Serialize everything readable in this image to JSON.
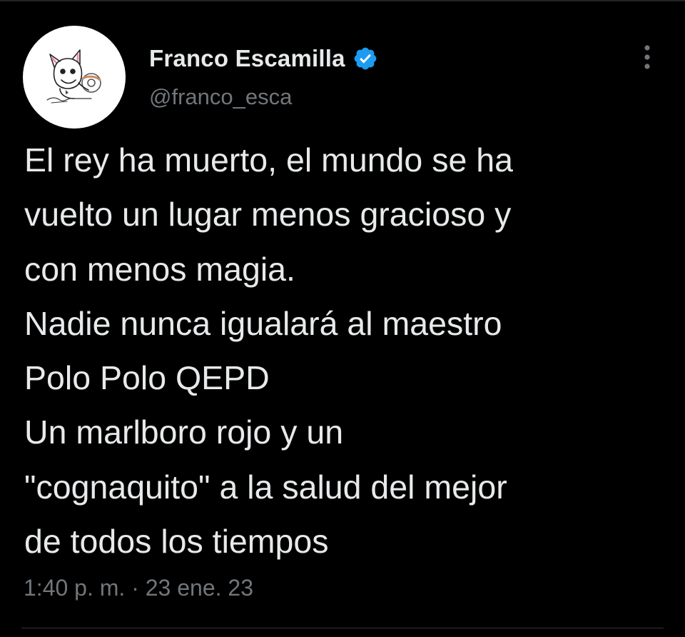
{
  "tweet": {
    "author": {
      "display_name": "Franco Escamilla",
      "handle": "@franco_esca",
      "verified": true,
      "avatar_icon": "cartoon-sketch-avatar",
      "verified_icon": "verified-badge-icon"
    },
    "more_icon": "more-options-icon",
    "text_lines": [
      "El rey ha muerto, el mundo se ha",
      "vuelto un lugar menos gracioso y",
      "con menos magia.",
      "Nadie nunca igualará al maestro",
      "Polo Polo QEPD",
      "Un marlboro rojo y un",
      "\"cognaquito\" a la salud del mejor",
      "de todos los tiempos"
    ],
    "timestamp": "1:40 p. m. · 23 ene. 23"
  },
  "colors": {
    "background": "#000000",
    "primary_text": "#e7e9ea",
    "secondary_text": "#71767b",
    "verified_blue": "#1d9bf0",
    "divider": "#2f3336"
  }
}
